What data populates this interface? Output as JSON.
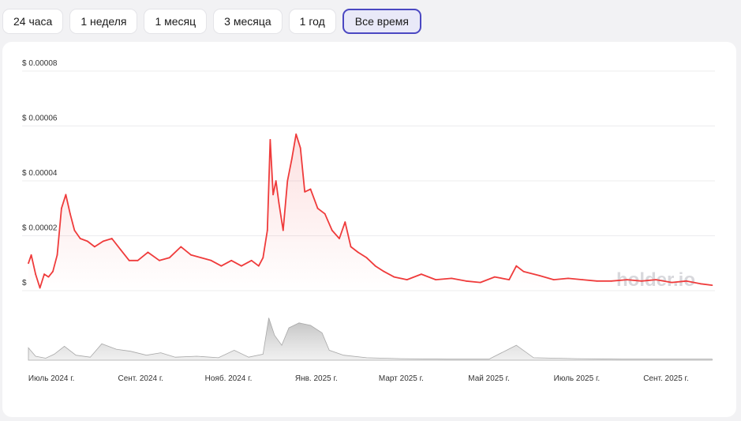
{
  "tabs": [
    {
      "label": "24 часа",
      "active": false
    },
    {
      "label": "1 неделя",
      "active": false
    },
    {
      "label": "1 месяц",
      "active": false
    },
    {
      "label": "3 месяца",
      "active": false
    },
    {
      "label": "1 год",
      "active": false
    },
    {
      "label": "Все время",
      "active": true
    }
  ],
  "watermark": "holder.io",
  "colors": {
    "price_line": "#ef3b3b",
    "volume": "#c4c4c4",
    "active_tab_border": "#4b48c2"
  },
  "chart_data": {
    "type": "line",
    "y_axis": {
      "range": [
        0,
        8e-05
      ],
      "tick_labels": [
        "$",
        "$ 0.00002",
        "$ 0.00004",
        "$ 0.00006",
        "$ 0.00008"
      ],
      "tick_values": [
        0,
        2e-05,
        4e-05,
        6e-05,
        8e-05
      ]
    },
    "x_axis": {
      "tick_labels": [
        "Июль 2024 г.",
        "Сент. 2024 г.",
        "Нояб. 2024 г.",
        "Янв. 2025 г.",
        "Март 2025 г.",
        "Май 2025 г.",
        "Июль 2025 г.",
        "Сент. 2025 г."
      ],
      "tick_dates": [
        "2024-07-01",
        "2024-09-01",
        "2024-11-01",
        "2025-01-01",
        "2025-03-01",
        "2025-05-01",
        "2025-07-01",
        "2025-09-01"
      ],
      "range": [
        "2024-06-15",
        "2025-10-05"
      ]
    },
    "grid": true,
    "series": [
      {
        "role": "price",
        "points": [
          [
            "2024-06-15",
            1e-05
          ],
          [
            "2024-06-17",
            1.3e-05
          ],
          [
            "2024-06-20",
            6e-06
          ],
          [
            "2024-06-23",
            1e-06
          ],
          [
            "2024-06-26",
            6e-06
          ],
          [
            "2024-06-29",
            5e-06
          ],
          [
            "2024-07-02",
            7e-06
          ],
          [
            "2024-07-05",
            1.3e-05
          ],
          [
            "2024-07-08",
            3e-05
          ],
          [
            "2024-07-11",
            3.5e-05
          ],
          [
            "2024-07-14",
            2.8e-05
          ],
          [
            "2024-07-17",
            2.2e-05
          ],
          [
            "2024-07-21",
            1.9e-05
          ],
          [
            "2024-07-26",
            1.8e-05
          ],
          [
            "2024-07-31",
            1.6e-05
          ],
          [
            "2024-08-06",
            1.8e-05
          ],
          [
            "2024-08-12",
            1.9e-05
          ],
          [
            "2024-08-18",
            1.5e-05
          ],
          [
            "2024-08-24",
            1.1e-05
          ],
          [
            "2024-08-30",
            1.1e-05
          ],
          [
            "2024-09-06",
            1.4e-05
          ],
          [
            "2024-09-14",
            1.1e-05
          ],
          [
            "2024-09-21",
            1.2e-05
          ],
          [
            "2024-09-29",
            1.6e-05
          ],
          [
            "2024-10-06",
            1.3e-05
          ],
          [
            "2024-10-13",
            1.2e-05
          ],
          [
            "2024-10-20",
            1.1e-05
          ],
          [
            "2024-10-27",
            9e-06
          ],
          [
            "2024-11-03",
            1.1e-05
          ],
          [
            "2024-11-10",
            9e-06
          ],
          [
            "2024-11-17",
            1.1e-05
          ],
          [
            "2024-11-22",
            9e-06
          ],
          [
            "2024-11-25",
            1.2e-05
          ],
          [
            "2024-11-28",
            2.2e-05
          ],
          [
            "2024-11-30",
            5.5e-05
          ],
          [
            "2024-12-02",
            3.5e-05
          ],
          [
            "2024-12-04",
            4e-05
          ],
          [
            "2024-12-06",
            3.2e-05
          ],
          [
            "2024-12-09",
            2.2e-05
          ],
          [
            "2024-12-12",
            4e-05
          ],
          [
            "2024-12-15",
            4.8e-05
          ],
          [
            "2024-12-18",
            5.7e-05
          ],
          [
            "2024-12-21",
            5.2e-05
          ],
          [
            "2024-12-24",
            3.6e-05
          ],
          [
            "2024-12-28",
            3.7e-05
          ],
          [
            "2025-01-02",
            3e-05
          ],
          [
            "2025-01-07",
            2.8e-05
          ],
          [
            "2025-01-12",
            2.2e-05
          ],
          [
            "2025-01-17",
            1.9e-05
          ],
          [
            "2025-01-21",
            2.5e-05
          ],
          [
            "2025-01-25",
            1.6e-05
          ],
          [
            "2025-01-30",
            1.4e-05
          ],
          [
            "2025-02-05",
            1.2e-05
          ],
          [
            "2025-02-11",
            9e-06
          ],
          [
            "2025-02-17",
            7e-06
          ],
          [
            "2025-02-24",
            5e-06
          ],
          [
            "2025-03-05",
            4e-06
          ],
          [
            "2025-03-15",
            6e-06
          ],
          [
            "2025-03-25",
            4e-06
          ],
          [
            "2025-04-05",
            4.5e-06
          ],
          [
            "2025-04-15",
            3.5e-06
          ],
          [
            "2025-04-25",
            3e-06
          ],
          [
            "2025-05-05",
            5e-06
          ],
          [
            "2025-05-15",
            4e-06
          ],
          [
            "2025-05-20",
            9e-06
          ],
          [
            "2025-05-25",
            7e-06
          ],
          [
            "2025-06-05",
            5.5e-06
          ],
          [
            "2025-06-15",
            4e-06
          ],
          [
            "2025-06-25",
            4.5e-06
          ],
          [
            "2025-07-05",
            4e-06
          ],
          [
            "2025-07-15",
            3.5e-06
          ],
          [
            "2025-07-25",
            3.5e-06
          ],
          [
            "2025-08-05",
            4e-06
          ],
          [
            "2025-08-15",
            3.5e-06
          ],
          [
            "2025-08-25",
            4e-06
          ],
          [
            "2025-09-05",
            3e-06
          ],
          [
            "2025-09-15",
            3.5e-06
          ],
          [
            "2025-09-25",
            2.5e-06
          ],
          [
            "2025-10-03",
            2e-06
          ]
        ]
      },
      {
        "role": "volume",
        "relative_levels": [
          [
            "2024-06-15",
            0.25
          ],
          [
            "2024-06-20",
            0.08
          ],
          [
            "2024-06-27",
            0.04
          ],
          [
            "2024-07-03",
            0.12
          ],
          [
            "2024-07-10",
            0.28
          ],
          [
            "2024-07-18",
            0.1
          ],
          [
            "2024-07-28",
            0.06
          ],
          [
            "2024-08-05",
            0.33
          ],
          [
            "2024-08-15",
            0.22
          ],
          [
            "2024-08-25",
            0.18
          ],
          [
            "2024-09-05",
            0.1
          ],
          [
            "2024-09-15",
            0.15
          ],
          [
            "2024-09-25",
            0.06
          ],
          [
            "2024-10-10",
            0.08
          ],
          [
            "2024-10-25",
            0.05
          ],
          [
            "2024-11-05",
            0.2
          ],
          [
            "2024-11-15",
            0.06
          ],
          [
            "2024-11-25",
            0.12
          ],
          [
            "2024-11-29",
            0.85
          ],
          [
            "2024-12-03",
            0.5
          ],
          [
            "2024-12-08",
            0.3
          ],
          [
            "2024-12-13",
            0.65
          ],
          [
            "2024-12-20",
            0.75
          ],
          [
            "2024-12-28",
            0.7
          ],
          [
            "2025-01-05",
            0.55
          ],
          [
            "2025-01-10",
            0.2
          ],
          [
            "2025-01-20",
            0.1
          ],
          [
            "2025-02-05",
            0.05
          ],
          [
            "2025-03-01",
            0.03
          ],
          [
            "2025-04-01",
            0.02
          ],
          [
            "2025-05-01",
            0.02
          ],
          [
            "2025-05-20",
            0.3
          ],
          [
            "2025-06-01",
            0.05
          ],
          [
            "2025-07-01",
            0.03
          ],
          [
            "2025-08-01",
            0.02
          ],
          [
            "2025-09-01",
            0.02
          ],
          [
            "2025-10-03",
            0.02
          ]
        ]
      }
    ]
  }
}
